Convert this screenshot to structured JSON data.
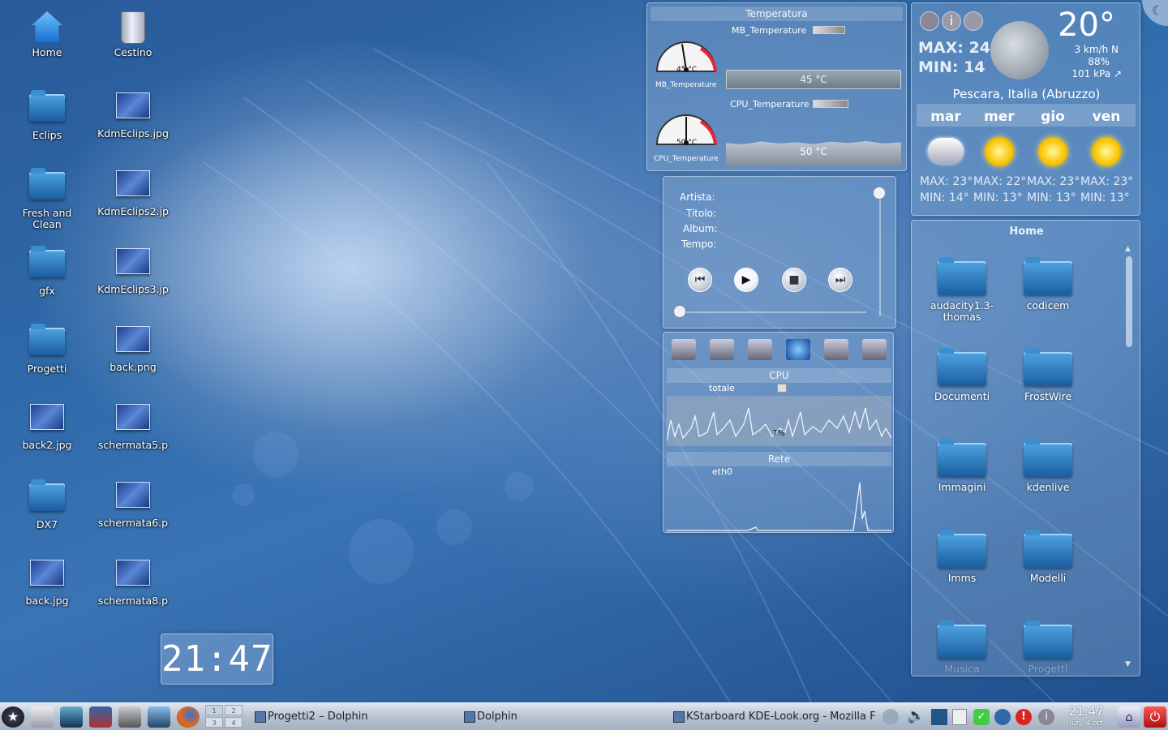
{
  "desktop": {
    "icons": [
      {
        "label": "Home",
        "type": "home-icon"
      },
      {
        "label": "Cestino",
        "type": "trash-icon"
      },
      {
        "label": "Eclips",
        "type": "folder-icon"
      },
      {
        "label": "KdmEclips.jpg",
        "type": "image-file-icon"
      },
      {
        "label": "Fresh and Clean",
        "type": "folder-icon"
      },
      {
        "label": "KdmEclips2.jp",
        "type": "image-file-icon"
      },
      {
        "label": "gfx",
        "type": "folder-icon"
      },
      {
        "label": "KdmEclips3.jp",
        "type": "image-file-icon"
      },
      {
        "label": "Progetti",
        "type": "folder-icon"
      },
      {
        "label": "back.png",
        "type": "image-file-icon"
      },
      {
        "label": "back2.jpg",
        "type": "image-file-icon"
      },
      {
        "label": "schermata5.p",
        "type": "image-file-icon"
      },
      {
        "label": "DX7",
        "type": "folder-icon"
      },
      {
        "label": "schermata6.p",
        "type": "image-file-icon"
      },
      {
        "label": "back.jpg",
        "type": "image-file-icon"
      },
      {
        "label": "schermata8.p",
        "type": "image-file-icon"
      }
    ]
  },
  "clock": {
    "time": "21:47"
  },
  "temperature": {
    "title": "Temperatura",
    "mb": {
      "label": "MB_Temperature",
      "gauge_label": "MB_Temperature",
      "value": "45 °C",
      "reading": 45
    },
    "cpu": {
      "label": "CPU_Temperature",
      "gauge_label": "CPU_Temperature",
      "value": "50 °C",
      "reading": 50
    }
  },
  "player": {
    "artist_label": "Artista:",
    "title_label": "Titolo:",
    "album_label": "Album:",
    "time_label": "Tempo:",
    "buttons": [
      "previous-icon",
      "play-icon",
      "stop-icon",
      "next-icon"
    ]
  },
  "sysmon": {
    "tabs": [
      "hard-drive-icon",
      "disk-icon",
      "hardware-icon",
      "network-globe-icon",
      "memory-icon",
      "chip-icon"
    ],
    "cpu_title": "CPU",
    "cpu_series": "totale",
    "cpu_value": "7%",
    "net_title": "Rete",
    "net_series": "eth0"
  },
  "weather": {
    "temp": "20°",
    "max": "MAX: 24",
    "min": "MIN: 14",
    "wind": "3 km/h N",
    "humidity": "88%",
    "pressure": "101 kPa ↗",
    "location": "Pescara, Italia (Abruzzo)",
    "days": [
      {
        "name": "mar",
        "icon": "cloudy-rain-icon",
        "max": "MAX: 23°",
        "min": "MIN: 14°"
      },
      {
        "name": "mer",
        "icon": "sun-icon",
        "max": "MAX: 22°",
        "min": "MIN: 13°"
      },
      {
        "name": "gio",
        "icon": "sun-icon",
        "max": "MAX: 23°",
        "min": "MIN: 13°"
      },
      {
        "name": "ven",
        "icon": "sun-icon",
        "max": "MAX: 23°",
        "min": "MIN: 13°"
      }
    ]
  },
  "folderview": {
    "title": "Home",
    "items": [
      "audacity1.3-thomas",
      "codicem",
      "Documenti",
      "FrostWire",
      "Immagini",
      "kdenlive",
      "Imms",
      "Modelli",
      "Musica",
      "Progetti"
    ]
  },
  "taskbar": {
    "pager": [
      "1",
      "2",
      "3",
      "4"
    ],
    "tasks": [
      "Progetti2 – Dolphin",
      "Dolphin",
      "KStarboard KDE-Look.org - Mozilla F"
    ],
    "clock_time": "21:47",
    "clock_date": "lun, 4 ott"
  }
}
